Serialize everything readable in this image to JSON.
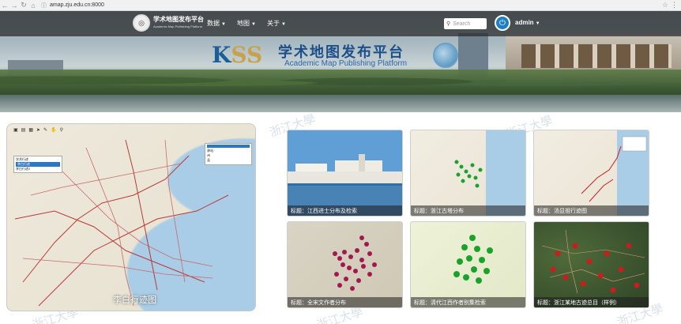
{
  "browser": {
    "url": "amap.zju.edu.cn:8000",
    "info_icon": "info-icon",
    "star_icon": "star-icon",
    "menu_icon": "menu-icon"
  },
  "topnav": {
    "logo_title": "学术地图发布平台",
    "logo_subtitle": "Academic Map Publishing Platform",
    "items": [
      {
        "label": "数据"
      },
      {
        "label": "地图"
      },
      {
        "label": "关于"
      }
    ],
    "search_placeholder": "Search",
    "user": "admin"
  },
  "banner": {
    "kss_k": "K",
    "kss_ss": "SS",
    "title": "学术地图发布平台",
    "subtitle": "Academic Map Publishing Platform"
  },
  "watermark": "浙江大學",
  "featured_map": {
    "caption": "李白行迹图",
    "tree_items": [
      "学术行迹",
      "李白行迹",
      "李白行迹2"
    ],
    "legend_items": [
      "驿站",
      "州",
      "县"
    ]
  },
  "maps": [
    {
      "caption": "标题：江西进士分布及检索"
    },
    {
      "caption": "标题：浙江古塔分布"
    },
    {
      "caption": "标题：汤显祖行迹图"
    },
    {
      "caption": "标题：全宋文作者分布"
    },
    {
      "caption": "标题：清代江西作者别集检索"
    },
    {
      "caption": "标题：浙江某地古迹总目（样例）"
    }
  ],
  "colors": {
    "nav_bg": "#282828",
    "brand_blue": "#1c4f8a",
    "power_blue": "#1e7fc2",
    "marker_crimson": "#a5184f",
    "marker_green": "#1aa32a",
    "marker_red": "#c81e1e"
  }
}
